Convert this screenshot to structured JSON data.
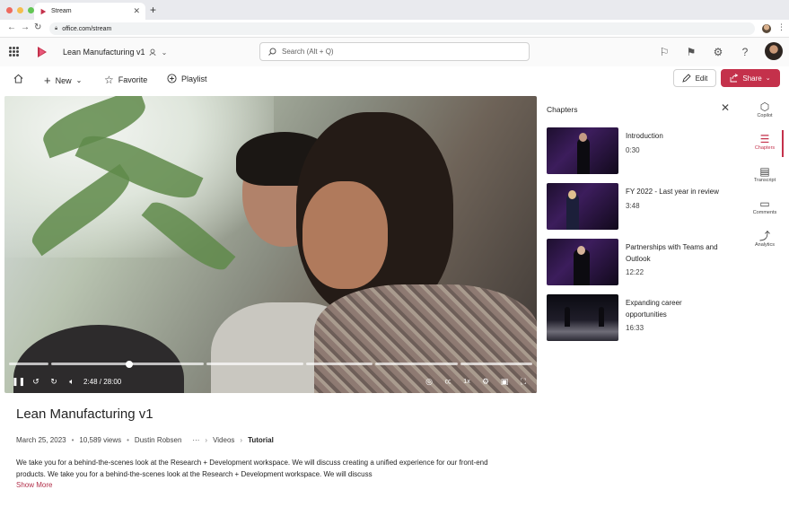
{
  "browser": {
    "tab_title": "Stream",
    "url": "office.com/stream",
    "dots": [
      "#ee6a5f",
      "#f5be4f",
      "#62c654"
    ]
  },
  "header": {
    "doc_title": "Lean Manufacturing  v1",
    "search_placeholder": "Search (Alt + Q)"
  },
  "commandbar": {
    "new_label": "New",
    "favorite_label": "Favorite",
    "playlist_label": "Playlist",
    "edit_label": "Edit",
    "share_label": "Share"
  },
  "player": {
    "time_display": "2:48 / 28:00",
    "progress": 0.1
  },
  "video": {
    "title": "Lean Manufacturing  v1",
    "date": "March 25, 2023",
    "views": "10,589 views",
    "author": "Dustin Robsen",
    "breadcrumb_videos": "Videos",
    "breadcrumb_current": "Tutorial",
    "description": "We take you for a behind-the-scenes look at the Research + Development workspace. We will discuss creating a unified experience for our front-end products. We take you for a behind-the-scenes look at the Research + Development workspace. We will discuss",
    "show_more": "Show More"
  },
  "chapters": {
    "title": "Chapters",
    "items": [
      {
        "title": "Introduction",
        "time": "0:30"
      },
      {
        "title": "FY 2022 - Last year in review",
        "time": "3:48"
      },
      {
        "title": "Partnerships with Teams and Outlook",
        "time": "12:22"
      },
      {
        "title": "Expanding career opportunities",
        "time": "16:33"
      }
    ]
  },
  "rail": {
    "copilot": "Copilot",
    "chapters": "Chapters",
    "transcript": "Transcript",
    "comments": "Comments",
    "analytics": "Analytics"
  },
  "colors": {
    "accent": "#c4314b",
    "link": "#b22f4a"
  }
}
